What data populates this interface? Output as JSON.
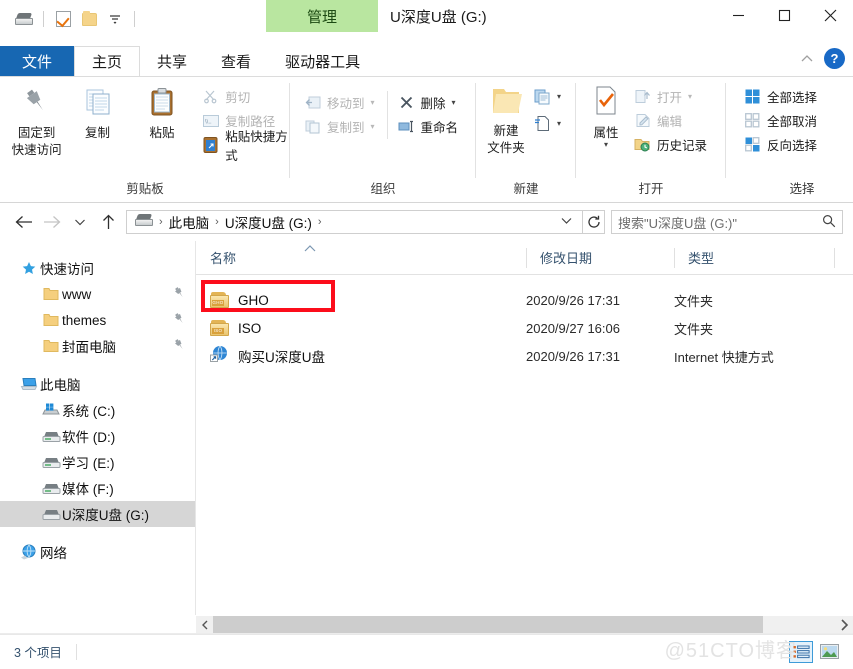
{
  "window": {
    "title": "U深度U盘 (G:)",
    "contextual_tab": "管理",
    "contextual_tab_color": "#b9e6a0",
    "minimize": "—",
    "maximize": "□",
    "close": "✕",
    "help": "?",
    "collapse_ribbon": "⌃"
  },
  "quick_access_toolbar": {
    "items": [
      {
        "name": "drive-icon",
        "label": ""
      },
      {
        "name": "properties-icon",
        "label": ""
      },
      {
        "name": "new-folder-icon",
        "label": ""
      },
      {
        "name": "customize-dropdown",
        "label": "▼"
      }
    ]
  },
  "tabs": [
    {
      "label": "文件",
      "id": "file",
      "active": false
    },
    {
      "label": "主页",
      "id": "home",
      "active": true
    },
    {
      "label": "共享",
      "id": "share",
      "active": false
    },
    {
      "label": "查看",
      "id": "view",
      "active": false
    },
    {
      "label": "驱动器工具",
      "id": "drive-tools",
      "active": false
    }
  ],
  "ribbon": {
    "groups": [
      {
        "label": "剪贴板",
        "big_buttons": [
          {
            "name": "pin-to-quick-access",
            "label_line1": "固定到",
            "label_line2": "快速访问",
            "icon": "pin-icon"
          },
          {
            "name": "copy",
            "label_line1": "复制",
            "label_line2": "",
            "icon": "copy-icon"
          },
          {
            "name": "paste",
            "label_line1": "粘贴",
            "label_line2": "",
            "icon": "paste-icon"
          }
        ],
        "small_buttons": [
          {
            "name": "cut",
            "label": "剪切",
            "icon": "scissors-icon",
            "disabled": true
          },
          {
            "name": "copy-path",
            "label": "复制路径",
            "icon": "copy-path-icon",
            "disabled": true
          },
          {
            "name": "paste-shortcut",
            "label": "粘贴快捷方式",
            "icon": "paste-shortcut-icon",
            "disabled": false
          }
        ]
      },
      {
        "label": "组织",
        "small_buttons": [
          {
            "name": "move-to",
            "label": "移动到",
            "icon": "move-to-icon",
            "disabled": true,
            "caret": "▾"
          },
          {
            "name": "copy-to",
            "label": "复制到",
            "icon": "copy-to-icon",
            "disabled": true,
            "caret": "▾"
          }
        ],
        "small_buttons2": [
          {
            "name": "delete",
            "label": "删除",
            "icon": "delete-x-icon",
            "disabled": false,
            "caret": "▾"
          },
          {
            "name": "rename",
            "label": "重命名",
            "icon": "rename-icon",
            "disabled": false,
            "caret": ""
          }
        ]
      },
      {
        "label": "新建",
        "big_buttons": [
          {
            "name": "new-folder",
            "label_line1": "新建",
            "label_line2": "文件夹",
            "icon": "folder-icon"
          }
        ],
        "small_buttons": [
          {
            "name": "new-item",
            "label": "",
            "icon": "new-item-icon",
            "disabled": false,
            "caret": "▾"
          },
          {
            "name": "easy-access",
            "label": "",
            "icon": "easy-access-icon",
            "disabled": false,
            "caret": "▾"
          }
        ]
      },
      {
        "label": "打开",
        "big_buttons": [
          {
            "name": "properties",
            "label_line1": "属性",
            "label_line2": "",
            "icon": "properties-icon",
            "caret": "▾"
          }
        ],
        "small_buttons": [
          {
            "name": "open",
            "label": "打开",
            "icon": "open-icon",
            "disabled": true,
            "caret": "▾"
          },
          {
            "name": "edit",
            "label": "编辑",
            "icon": "edit-icon",
            "disabled": true,
            "caret": ""
          },
          {
            "name": "history",
            "label": "历史记录",
            "icon": "history-icon",
            "disabled": false,
            "caret": ""
          }
        ]
      },
      {
        "label": "选择",
        "small_buttons": [
          {
            "name": "select-all",
            "label": "全部选择",
            "icon": "select-all-icon",
            "disabled": false
          },
          {
            "name": "select-none",
            "label": "全部取消",
            "icon": "select-none-icon",
            "disabled": false
          },
          {
            "name": "invert-selection",
            "label": "反向选择",
            "icon": "invert-selection-icon",
            "disabled": false
          }
        ]
      }
    ]
  },
  "address_bar": {
    "back": "←",
    "forward": "→",
    "recent": "⌄",
    "up": "↑",
    "breadcrumbs": [
      "此电脑",
      "U深度U盘 (G:)"
    ],
    "separator": "›",
    "dropdown_caret": "⌄",
    "refresh": "↻"
  },
  "search": {
    "placeholder": "搜索\"U深度U盘 (G:)\"",
    "icon": "search-icon"
  },
  "nav_pane": {
    "items": [
      {
        "label": "快速访问",
        "icon": "star-pin-icon",
        "level": 0,
        "pinned": false,
        "selected": false
      },
      {
        "label": "www",
        "icon": "folder-icon",
        "level": 1,
        "pinned": true,
        "selected": false
      },
      {
        "label": "themes",
        "icon": "folder-icon",
        "level": 1,
        "pinned": true,
        "selected": false
      },
      {
        "label": "封面电脑",
        "icon": "folder-icon",
        "level": 1,
        "pinned": true,
        "selected": false
      },
      {
        "label": "此电脑",
        "icon": "this-pc-icon",
        "level": 0,
        "pinned": false,
        "selected": false
      },
      {
        "label": "系统 (C:)",
        "icon": "windows-drive-icon",
        "level": 1,
        "pinned": false,
        "selected": false
      },
      {
        "label": "软件 (D:)",
        "icon": "drive-icon",
        "level": 1,
        "pinned": false,
        "selected": false
      },
      {
        "label": "学习 (E:)",
        "icon": "drive-icon",
        "level": 1,
        "pinned": false,
        "selected": false
      },
      {
        "label": "媒体 (F:)",
        "icon": "drive-icon",
        "level": 1,
        "pinned": false,
        "selected": false
      },
      {
        "label": "U深度U盘 (G:)",
        "icon": "drive-icon",
        "level": 1,
        "pinned": false,
        "selected": true
      },
      {
        "label": "网络",
        "icon": "network-icon",
        "level": 0,
        "pinned": false,
        "selected": false
      }
    ],
    "pin_glyph": "📌"
  },
  "file_list": {
    "columns": [
      {
        "label": "名称",
        "sorted": "asc",
        "sort_glyph": "⌃"
      },
      {
        "label": "修改日期",
        "sorted": "",
        "sort_glyph": ""
      },
      {
        "label": "类型",
        "sorted": "",
        "sort_glyph": ""
      }
    ],
    "rows": [
      {
        "name": "GHO",
        "date": "2020/9/26 17:31",
        "type": "文件夹",
        "icon": "labeled-folder-icon",
        "icon_label": "GHO",
        "highlighted": true
      },
      {
        "name": "ISO",
        "date": "2020/9/27 16:06",
        "type": "文件夹",
        "icon": "labeled-folder-icon",
        "icon_label": "ISO",
        "highlighted": false
      },
      {
        "name": "购买U深度U盘",
        "date": "2020/9/26 17:31",
        "type": "Internet 快捷方式",
        "icon": "internet-shortcut-icon",
        "icon_label": "",
        "highlighted": false
      }
    ],
    "highlight_color": "#fc0d1b"
  },
  "status_bar": {
    "item_count": "3 个项目",
    "view_buttons": [
      {
        "name": "details-view-button",
        "active": true
      },
      {
        "name": "large-icons-view-button",
        "active": false
      }
    ]
  },
  "watermark": "@51CTO博客",
  "scrollbar": {
    "left_arrow": "‹",
    "right_arrow": "›"
  }
}
